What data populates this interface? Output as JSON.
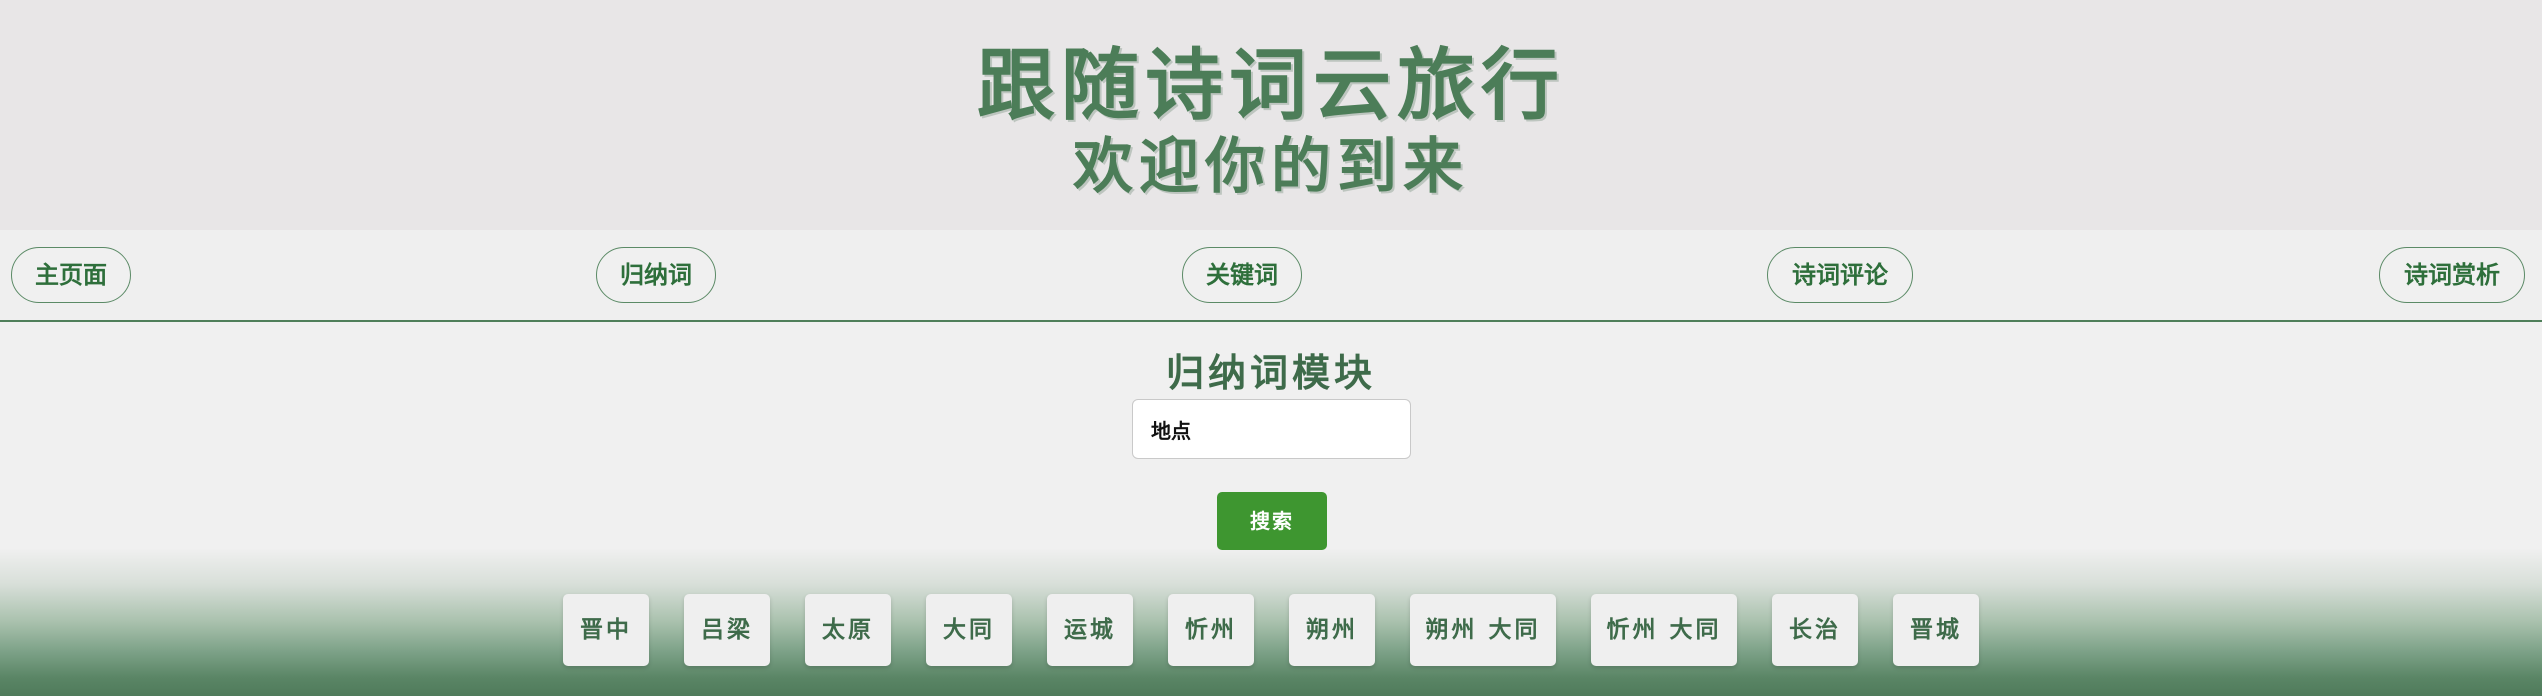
{
  "header": {
    "title": "跟随诗词云旅行",
    "subtitle": "欢迎你的到来"
  },
  "nav": {
    "items": [
      {
        "label": "主页面"
      },
      {
        "label": "归纳词"
      },
      {
        "label": "关键词"
      },
      {
        "label": "诗词评论"
      },
      {
        "label": "诗词赏析"
      }
    ]
  },
  "section": {
    "title": "归纳词模块"
  },
  "search": {
    "value": "地点",
    "button_label": "搜索"
  },
  "places": [
    {
      "label": "晋中"
    },
    {
      "label": "吕梁"
    },
    {
      "label": "太原"
    },
    {
      "label": "大同"
    },
    {
      "label": "运城"
    },
    {
      "label": "忻州"
    },
    {
      "label": "朔州"
    },
    {
      "label": "朔州 大同"
    },
    {
      "label": "忻州 大同"
    },
    {
      "label": "长治"
    },
    {
      "label": "晋城"
    }
  ],
  "colors": {
    "title_green": "#4c7d58",
    "nav_text": "#2e6f3b",
    "search_button": "#3e9630",
    "header_bg": "#e8e6e7",
    "gradient_bottom": "#4f7b5b"
  }
}
